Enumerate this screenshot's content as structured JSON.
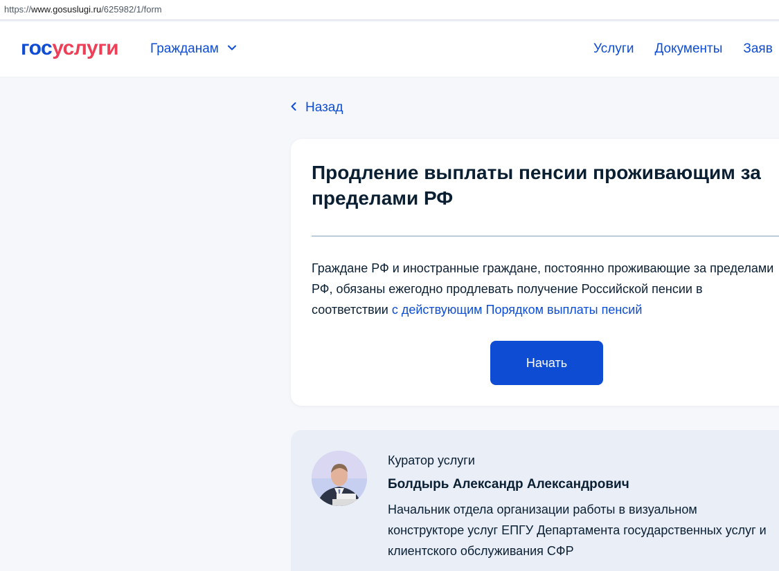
{
  "browser": {
    "url_scheme": "https://",
    "url_host": "www.gosuslugi.ru",
    "url_path": "/625982/1/form"
  },
  "header": {
    "logo_part1": "гос",
    "logo_part2": "услуги",
    "citizens_menu": "Гражданам",
    "nav": [
      "Услуги",
      "Документы",
      "Заяв"
    ]
  },
  "back_label": "Назад",
  "service": {
    "title": "Продление выплаты пенсии проживающим за пределами РФ",
    "description": "Граждане РФ и иностранные граждане, постоянно проживающие за пределами РФ, обязаны ежегодно продлевать получение Российской пенсии в соответствии",
    "link_text": "с действующим Порядком выплаты пенсий",
    "start_button": "Начать"
  },
  "curator": {
    "role": "Куратор услуги",
    "name": "Болдырь Александр Александрович",
    "position": "Начальник отдела организации работы в визуальном конструкторе услуг ЕПГУ Департамента государственных услуг и клиентского обслуживания СФР"
  },
  "colors": {
    "brand_blue": "#0d4cd3",
    "brand_red": "#ee3f58",
    "page_bg": "#f5f7fb",
    "curator_bg": "#e9eef7"
  }
}
